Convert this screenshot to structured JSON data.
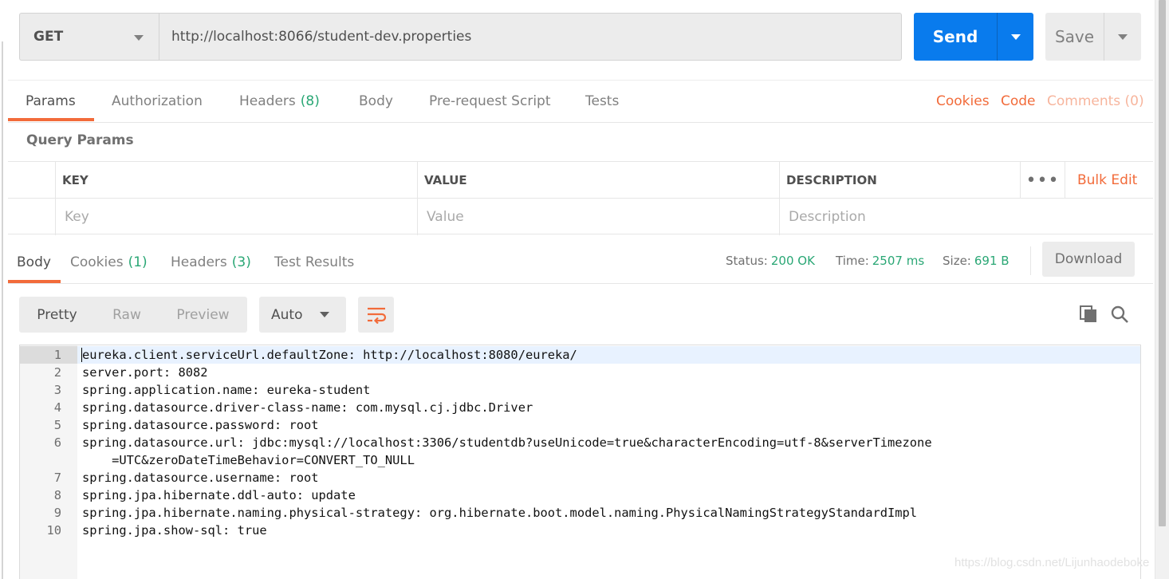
{
  "request": {
    "method": "GET",
    "url": "http://localhost:8066/student-dev.properties",
    "send_label": "Send",
    "save_label": "Save"
  },
  "request_tabs": [
    {
      "label": "Params",
      "active": true
    },
    {
      "label": "Authorization"
    },
    {
      "label": "Headers",
      "count": "(8)"
    },
    {
      "label": "Body"
    },
    {
      "label": "Pre-request Script"
    },
    {
      "label": "Tests"
    }
  ],
  "request_links": {
    "cookies": "Cookies",
    "code": "Code",
    "comments": "Comments (0)"
  },
  "query_params": {
    "title": "Query Params",
    "columns": [
      "KEY",
      "VALUE",
      "DESCRIPTION"
    ],
    "more": "•••",
    "bulk_edit": "Bulk Edit",
    "placeholders": {
      "key": "Key",
      "value": "Value",
      "description": "Description"
    }
  },
  "response_tabs": [
    {
      "label": "Body",
      "active": true
    },
    {
      "label": "Cookies",
      "count": "(1)"
    },
    {
      "label": "Headers",
      "count": "(3)"
    },
    {
      "label": "Test Results"
    }
  ],
  "response_meta": {
    "status_label": "Status:",
    "status_value": "200 OK",
    "time_label": "Time:",
    "time_value": "2507 ms",
    "size_label": "Size:",
    "size_value": "691 B",
    "download": "Download"
  },
  "body_toolbar": {
    "views": [
      "Pretty",
      "Raw",
      "Preview"
    ],
    "active_view": "Pretty",
    "format": "Auto",
    "icons": [
      "wrap-lines-icon",
      "copy-icon",
      "search-icon"
    ]
  },
  "code_lines": [
    {
      "n": "1",
      "text": "eureka.client.serviceUrl.defaultZone: http://localhost:8080/eureka/"
    },
    {
      "n": "2",
      "text": "server.port: 8082"
    },
    {
      "n": "3",
      "text": "spring.application.name: eureka-student"
    },
    {
      "n": "4",
      "text": "spring.datasource.driver-class-name: com.mysql.cj.jdbc.Driver"
    },
    {
      "n": "5",
      "text": "spring.datasource.password: root"
    },
    {
      "n": "6",
      "text": "spring.datasource.url: jdbc:mysql://localhost:3306/studentdb?useUnicode=true&characterEncoding=utf-8&serverTimezone"
    },
    {
      "n": "",
      "text": "    =UTC&zeroDateTimeBehavior=CONVERT_TO_NULL"
    },
    {
      "n": "7",
      "text": "spring.datasource.username: root"
    },
    {
      "n": "8",
      "text": "spring.jpa.hibernate.ddl-auto: update"
    },
    {
      "n": "9",
      "text": "spring.jpa.hibernate.naming.physical-strategy: org.hibernate.boot.model.naming.PhysicalNamingStrategyStandardImpl"
    },
    {
      "n": "10",
      "text": "spring.jpa.show-sql: true"
    }
  ],
  "watermark": "https://blog.csdn.net/Lijunhaodeboke",
  "colors": {
    "accent_orange": "#f26b3a",
    "send_blue": "#097bed",
    "status_green": "#2aa775"
  }
}
